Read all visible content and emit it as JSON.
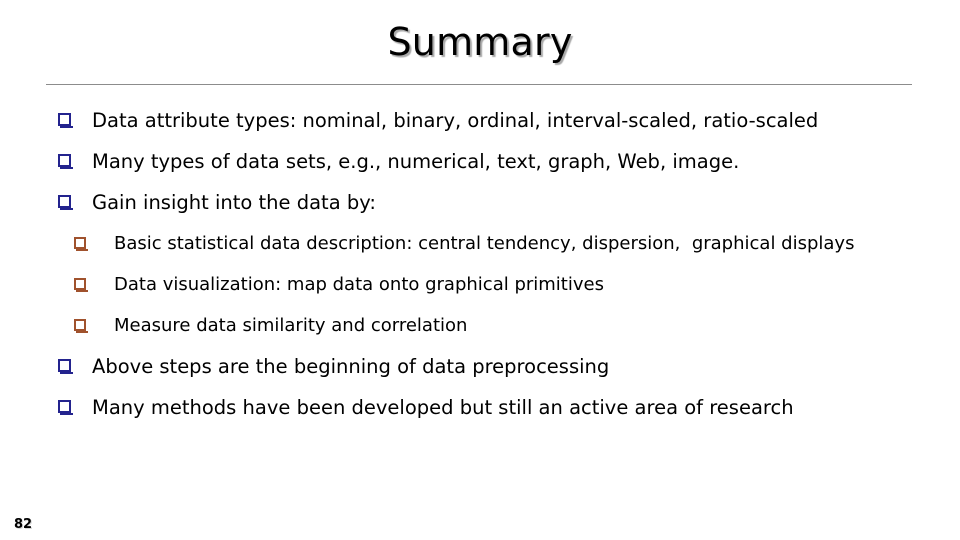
{
  "slide": {
    "title": "Summary",
    "page_number": "82",
    "colors": {
      "title_text": "#000000",
      "title_shadow": "#8c8c8c",
      "rule": "#8c8c8c",
      "level1_bullet": "#23238e",
      "level2_bullet": "#a0522d",
      "body_text": "#000000",
      "background": "#ffffff"
    },
    "bullets": [
      {
        "level": 1,
        "marker": "hollow-square-navy",
        "text": "Data attribute types: nominal, binary, ordinal, interval-scaled, ratio-scaled"
      },
      {
        "level": 1,
        "marker": "hollow-square-navy",
        "text": "Many types of data sets, e.g., numerical, text, graph, Web, image."
      },
      {
        "level": 1,
        "marker": "hollow-square-navy",
        "text": "Gain insight into the data by:"
      },
      {
        "level": 2,
        "marker": "hollow-square-brown",
        "text": "Basic statistical data description: central tendency, dispersion,  graphical displays"
      },
      {
        "level": 2,
        "marker": "hollow-square-brown",
        "text": "Data visualization: map data onto graphical primitives"
      },
      {
        "level": 2,
        "marker": "hollow-square-brown",
        "text": "Measure data similarity and correlation"
      },
      {
        "level": 1,
        "marker": "hollow-square-navy",
        "text": "Above steps are the beginning of data preprocessing"
      },
      {
        "level": 1,
        "marker": "hollow-square-navy",
        "text": "Many methods have been developed but still an active area of research"
      }
    ]
  }
}
